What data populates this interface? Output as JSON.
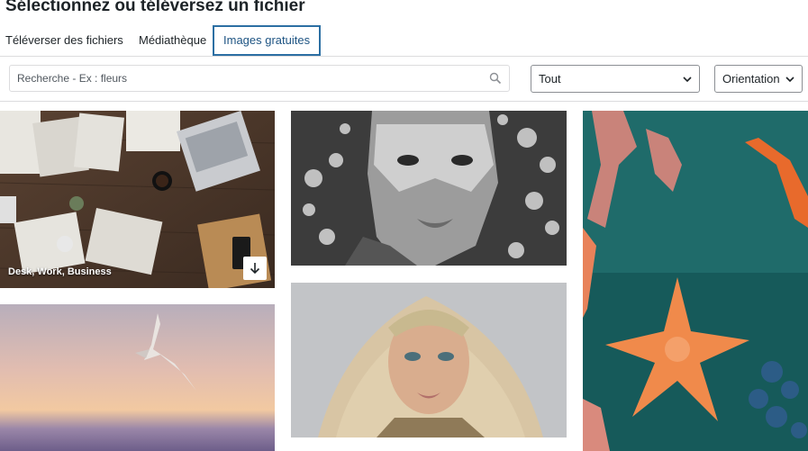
{
  "header": {
    "title": "Sélectionnez ou téléversez un fichier"
  },
  "tabs": [
    {
      "label": "Téléverser des fichiers",
      "active": false
    },
    {
      "label": "Médiathèque",
      "active": false
    },
    {
      "label": "Images gratuites",
      "active": true
    }
  ],
  "search": {
    "placeholder": "Recherche - Ex : fleurs",
    "icon": "search-icon"
  },
  "filters": {
    "type_select": {
      "value": "Tout",
      "icon": "chevron-down-icon"
    },
    "orientation_select": {
      "value": "Orientation",
      "icon": "chevron-down-icon"
    }
  },
  "gallery": {
    "items": [
      {
        "caption": "Desk, Work, Business",
        "download_icon": "download-arrow-icon"
      },
      {
        "caption": ""
      },
      {
        "caption": ""
      },
      {
        "caption": ""
      },
      {
        "caption": ""
      }
    ]
  },
  "colors": {
    "accent": "#2c6fa3",
    "border": "#dcdcde",
    "text": "#1d2327"
  }
}
